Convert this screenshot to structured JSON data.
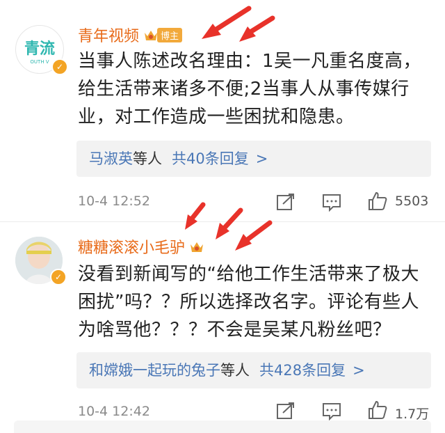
{
  "comments": [
    {
      "name": "青年视频",
      "tag": "博主",
      "avatar_text": "青流",
      "avatar_sub": "OUTH V",
      "text": "当事人陈述改名理由：1吴一凡重名度高，给生活带来诸多不便;2当事人从事传媒行业，对工作造成一些困扰和隐患。",
      "reply_who": "马淑英",
      "reply_etc": "等人",
      "reply_count": "共40条回复",
      "reply_chevron": ">",
      "time": "10-4 12:52",
      "likes": "5503"
    },
    {
      "name": "糖糖滚滚小毛驴",
      "text": "没看到新闻写的“给他工作生活带来了极大困扰”吗？？所以选择改名字。评论有些人为啥骂他？？？不会是吴某凡粉丝吧？",
      "reply_who": "和嫦娥一起玩的兔子",
      "reply_etc": "等人",
      "reply_count": "共428条回复",
      "reply_chevron": ">",
      "time": "10-4 12:42",
      "likes": "1.7万"
    }
  ],
  "colors": {
    "name": "#e86b1a",
    "link": "#4a77b6",
    "arrow": "#e8322a",
    "badge": "#f2a93b"
  },
  "icons": [
    "crown-icon",
    "verified-icon",
    "share-icon",
    "comment-icon",
    "like-icon",
    "arrow-icon"
  ]
}
